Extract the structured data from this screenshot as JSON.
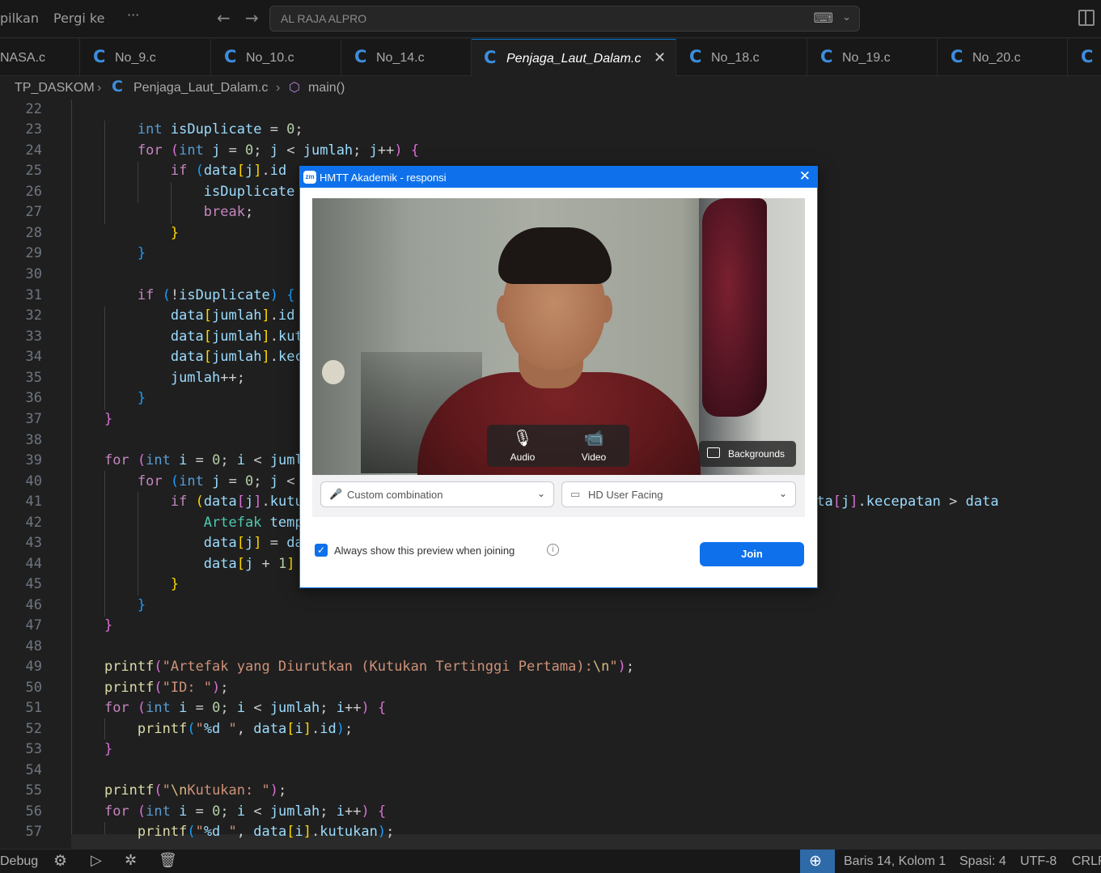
{
  "menu": {
    "item1": "pilkan",
    "item2": "Pergi ke",
    "more": "···"
  },
  "nav": {
    "back": "←",
    "forward": "→"
  },
  "command_center": {
    "label": "AL RAJA ALPRO"
  },
  "tabs": [
    {
      "label": "NASA.c",
      "active": false
    },
    {
      "label": "No_9.c",
      "active": false
    },
    {
      "label": "No_10.c",
      "active": false
    },
    {
      "label": "No_14.c",
      "active": false
    },
    {
      "label": "Penjaga_Laut_Dalam.c",
      "active": true
    },
    {
      "label": "No_18.c",
      "active": false
    },
    {
      "label": "No_19.c",
      "active": false
    },
    {
      "label": "No_20.c",
      "active": false
    },
    {
      "label": "",
      "active": false
    }
  ],
  "tab_icon_glyph": "C",
  "breadcrumb": {
    "folder": "TP_DASKOM",
    "file": "Penjaga_Laut_Dalam.c",
    "symbol": "main()"
  },
  "editor": {
    "line_numbers": [
      "22",
      "23",
      "24",
      "25",
      "26",
      "27",
      "28",
      "29",
      "30",
      "31",
      "32",
      "33",
      "34",
      "35",
      "36",
      "37",
      "38",
      "39",
      "40",
      "41",
      "42",
      "43",
      "44",
      "45",
      "46",
      "47",
      "48",
      "49",
      "50",
      "51",
      "52",
      "53",
      "54",
      "55",
      "56",
      "57"
    ]
  },
  "statusbar": {
    "debug": "Debug",
    "position": "Baris 14, Kolom 1",
    "spaces": "Spasi: 4",
    "encoding": "UTF-8",
    "eol": "CRLF"
  },
  "dialog": {
    "title": "HMTT Akademik - responsi",
    "logo_text": "zm",
    "audio_label": "Audio",
    "video_label": "Video",
    "backgrounds_label": "Backgrounds",
    "mic_select": "Custom combination",
    "camera_select": "HD User Facing",
    "always_show": "Always show this preview when joining",
    "join": "Join"
  },
  "colors": {
    "accent": "#0e71eb",
    "editor_bg": "#1f1f1f",
    "status_zoom": "#2e6aa8"
  }
}
